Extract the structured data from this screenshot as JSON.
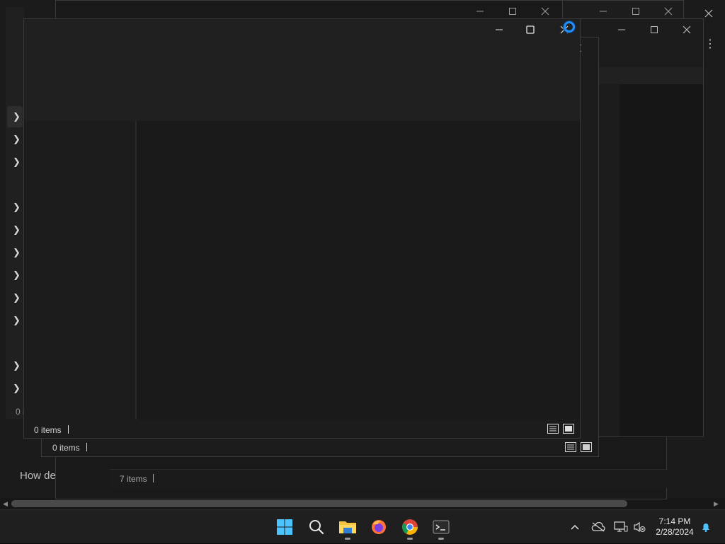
{
  "background_window": {
    "left_panel_partial_text": "How de",
    "status_partial": "0 i"
  },
  "explorer_back": {
    "status_items": "7 items"
  },
  "explorer_middle": {
    "status_items": "0 items"
  },
  "explorer_front": {
    "status_items": "0 items"
  },
  "taskbar": {
    "pinned": [
      {
        "name": "start",
        "icon": "windows-start-icon"
      },
      {
        "name": "search",
        "icon": "search-icon"
      },
      {
        "name": "file-explorer",
        "icon": "folder-icon",
        "running": true
      },
      {
        "name": "firefox",
        "icon": "firefox-icon",
        "running": false
      },
      {
        "name": "chrome",
        "icon": "chrome-icon",
        "running": true
      },
      {
        "name": "terminal",
        "icon": "terminal-icon",
        "running": true
      }
    ],
    "clock_time": "7:14 PM",
    "clock_date": "2/28/2024"
  },
  "colors": {
    "accent": "#0078d4",
    "taskbar_bg": "#1f1f1f",
    "window_bg": "#1c1c1c"
  }
}
